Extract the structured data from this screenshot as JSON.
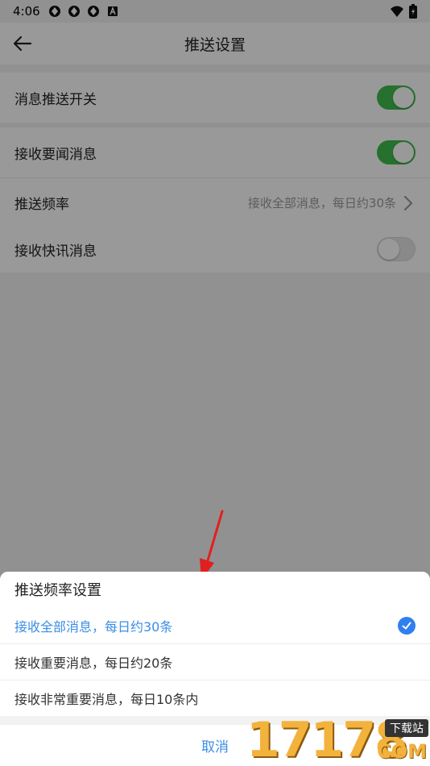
{
  "status_bar": {
    "time": "4:06"
  },
  "header": {
    "title": "推送设置"
  },
  "settings": {
    "push_switch": {
      "label": "消息推送开关",
      "on": true
    },
    "important_news": {
      "label": "接收要闻消息",
      "on": true
    },
    "frequency": {
      "label": "推送频率",
      "value": "接收全部消息，每日约30条"
    },
    "flash_news": {
      "label": "接收快讯消息",
      "on": false
    }
  },
  "sheet": {
    "title": "推送频率设置",
    "options": [
      {
        "label": "接收全部消息，每日约30条",
        "selected": true
      },
      {
        "label": "接收重要消息，每日约20条",
        "selected": false
      },
      {
        "label": "接收非常重要消息，每日10条内",
        "selected": false
      }
    ],
    "cancel_label": "取消"
  },
  "watermark": {
    "number": "17178",
    "tag": "下载站",
    "suffix": "COM"
  },
  "colors": {
    "accent": "#3a8ee6",
    "switch_on": "#3ebd4b",
    "annotation": "#e02020"
  }
}
